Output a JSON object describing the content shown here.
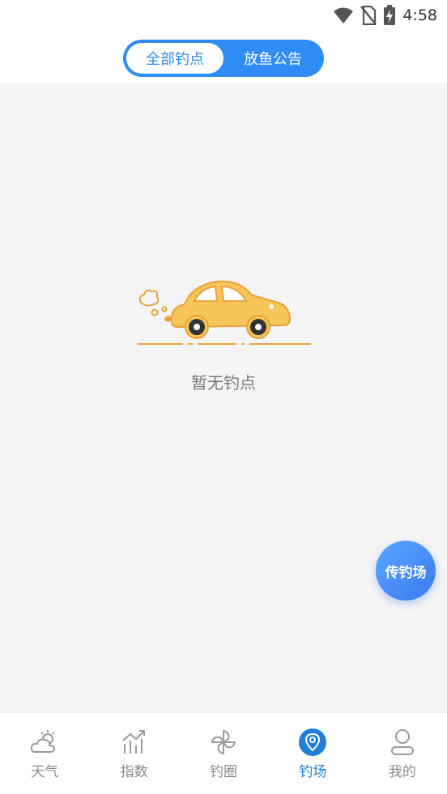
{
  "status_bar": {
    "time": "4:58",
    "icons": [
      "wifi-icon",
      "no-sim-icon",
      "battery-charging-icon"
    ]
  },
  "segmented": {
    "active_label": "全部钓点",
    "inactive_label": "放鱼公告"
  },
  "empty_state": {
    "message": "暂无钓点",
    "illustration": "car-icon"
  },
  "fab": {
    "label": "传钓场"
  },
  "tabbar": {
    "items": [
      {
        "label": "天气",
        "icon": "weather-icon"
      },
      {
        "label": "指数",
        "icon": "index-chart-icon"
      },
      {
        "label": "钓圈",
        "icon": "pinwheel-icon"
      },
      {
        "label": "钓场",
        "icon": "location-pin-icon"
      },
      {
        "label": "我的",
        "icon": "profile-icon"
      }
    ],
    "active_index": 3
  },
  "colors": {
    "accent": "#2f8bf5",
    "active_tab": "#1f7fd6",
    "background": "#f4f4f5",
    "car": "#f5c04a"
  }
}
